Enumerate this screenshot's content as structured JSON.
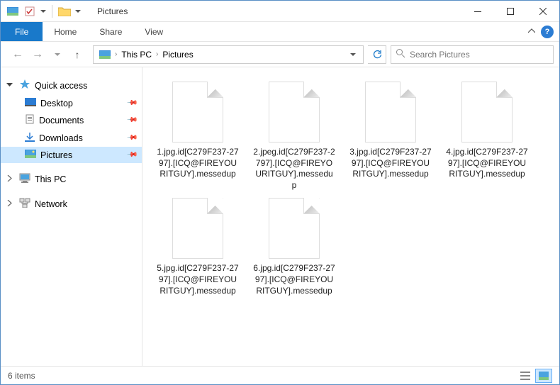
{
  "titlebar": {
    "title": "Pictures"
  },
  "ribbon": {
    "file": "File",
    "home": "Home",
    "share": "Share",
    "view": "View"
  },
  "breadcrumb": {
    "seg1": "This PC",
    "seg2": "Pictures"
  },
  "search": {
    "placeholder": "Search Pictures"
  },
  "sidebar": {
    "quick_access": "Quick access",
    "desktop": "Desktop",
    "documents": "Documents",
    "downloads": "Downloads",
    "pictures": "Pictures",
    "this_pc": "This PC",
    "network": "Network"
  },
  "files": {
    "items": [
      "1.jpg.id[C279F237-2797].[ICQ@FIREYOURITGUY].messedup",
      "2.jpeg.id[C279F237-2797].[ICQ@FIREYOURITGUY].messedup",
      "3.jpg.id[C279F237-2797].[ICQ@FIREYOURITGUY].messedup",
      "4.jpg.id[C279F237-2797].[ICQ@FIREYOURITGUY].messedup",
      "5.jpg.id[C279F237-2797].[ICQ@FIREYOURITGUY].messedup",
      "6.jpg.id[C279F237-2797].[ICQ@FIREYOURITGUY].messedup"
    ]
  },
  "statusbar": {
    "count": "6 items"
  }
}
